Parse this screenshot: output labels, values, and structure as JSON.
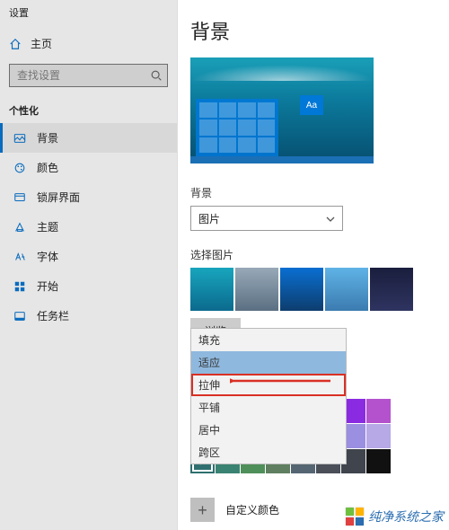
{
  "sidebar": {
    "app_title": "设置",
    "home_label": "主页",
    "search_placeholder": "查找设置",
    "group_label": "个性化",
    "items": [
      {
        "label": "背景",
        "icon": "background-icon",
        "selected": true
      },
      {
        "label": "颜色",
        "icon": "colors-icon"
      },
      {
        "label": "锁屏界面",
        "icon": "lockscreen-icon"
      },
      {
        "label": "主题",
        "icon": "themes-icon"
      },
      {
        "label": "字体",
        "icon": "fonts-icon"
      },
      {
        "label": "开始",
        "icon": "start-icon"
      },
      {
        "label": "任务栏",
        "icon": "taskbar-icon"
      }
    ]
  },
  "main": {
    "title": "背景",
    "preview_aa": "Aa",
    "bg_label": "背景",
    "bg_value": "图片",
    "pick_label": "选择图片",
    "browse_label": "浏览",
    "fit_options": [
      "填充",
      "适应",
      "拉伸",
      "平铺",
      "居中",
      "跨区"
    ],
    "fit_highlight_index": 1,
    "fit_boxed_index": 2,
    "colors_row1": [
      "#8a2be2",
      "#b452cd"
    ],
    "colors_row2": [
      "#1e7a1e",
      "#2aa12a",
      "#009e7a",
      "#0088a6",
      "#1d6fbf",
      "#6e6ed6",
      "#9a8fe0",
      "#b7a8e6"
    ],
    "colors_row3": [
      "#2f6f6f",
      "#3a8272",
      "#4f8f5a",
      "#5f7f60",
      "#556672",
      "#4a4f58",
      "#3f444d",
      "#111111"
    ],
    "selected_color_index": 16,
    "custom_label": "自定义颜色"
  },
  "watermark": "纯净系统之家"
}
